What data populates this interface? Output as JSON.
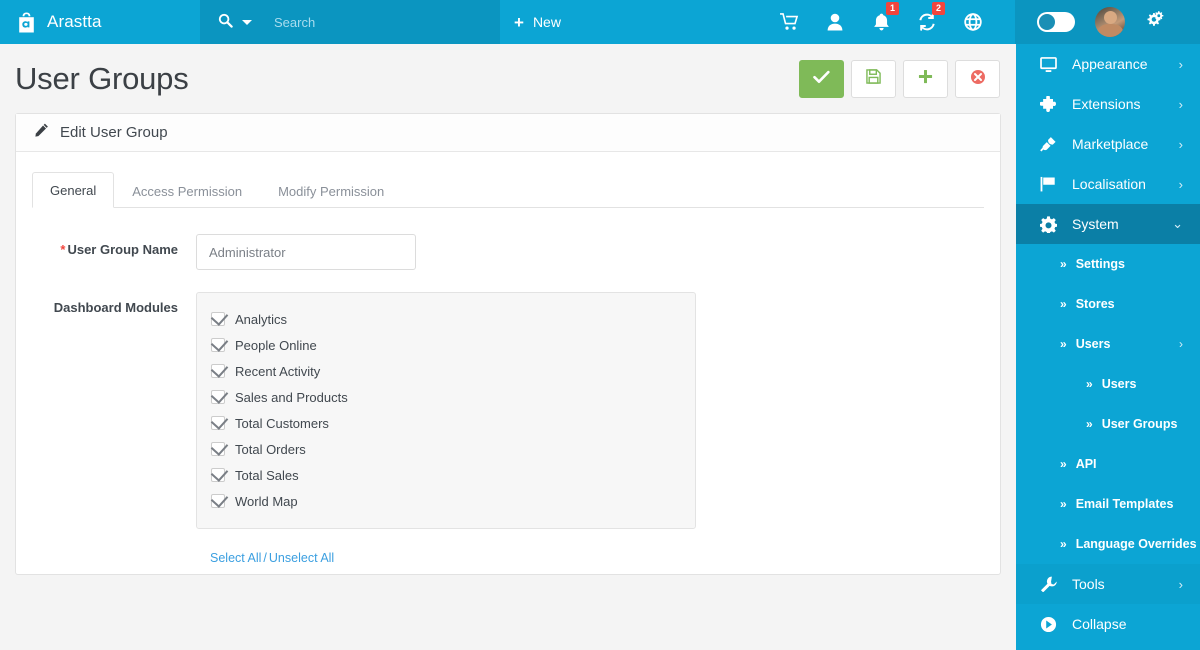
{
  "topbar": {
    "brand": "Arastta",
    "brand_icon": "arastta-logo-icon",
    "search_placeholder": "Search",
    "search_value": "",
    "search_icon": "search-icon",
    "search_caret_icon": "caret-down-icon",
    "new_label": "New",
    "new_icon": "plus-icon",
    "icons": [
      {
        "name": "cart-icon",
        "badge": ""
      },
      {
        "name": "user-icon",
        "badge": ""
      },
      {
        "name": "bell-icon",
        "badge": "1"
      },
      {
        "name": "sync-icon",
        "badge": "2"
      },
      {
        "name": "help-globe-icon",
        "badge": ""
      }
    ],
    "toggle_name": "dark-mode-toggle",
    "avatar_name": "user-avatar",
    "settings_icon": "gears-icon"
  },
  "page": {
    "title": "User Groups",
    "actions": [
      {
        "name": "save-button",
        "icon": "check-icon",
        "style": "primary"
      },
      {
        "name": "save-and-stay-button",
        "icon": "floppy-disk-icon",
        "style": "outline-green"
      },
      {
        "name": "add-new-button",
        "icon": "plus-icon",
        "style": "outline-green"
      },
      {
        "name": "cancel-button",
        "icon": "cancel-circle-icon",
        "style": "outline-red"
      }
    ]
  },
  "panel": {
    "header_icon": "pencil-icon",
    "header_title": "Edit User Group",
    "tabs": [
      {
        "label": "General",
        "active": true
      },
      {
        "label": "Access Permission",
        "active": false
      },
      {
        "label": "Modify Permission",
        "active": false
      }
    ],
    "form": {
      "group_name_label": "User Group Name",
      "group_name_required": "*",
      "group_name_value": "Administrator",
      "group_name_placeholder": "",
      "dashboard_modules_label": "Dashboard Modules",
      "modules": [
        {
          "label": "Analytics",
          "checked": true
        },
        {
          "label": "People Online",
          "checked": true
        },
        {
          "label": "Recent Activity",
          "checked": true
        },
        {
          "label": "Sales and Products",
          "checked": true
        },
        {
          "label": "Total Customers",
          "checked": true
        },
        {
          "label": "Total Orders",
          "checked": true
        },
        {
          "label": "Total Sales",
          "checked": true
        },
        {
          "label": "World Map",
          "checked": true
        }
      ],
      "select_all_label": "Select All",
      "separator": "/",
      "unselect_all_label": "Unselect All"
    }
  },
  "sidebar": {
    "items": [
      {
        "label": "Appearance",
        "icon": "monitor-icon",
        "chevron": "›"
      },
      {
        "label": "Extensions",
        "icon": "puzzle-icon",
        "chevron": "›"
      },
      {
        "label": "Marketplace",
        "icon": "plug-icon",
        "chevron": "›"
      },
      {
        "label": "Localisation",
        "icon": "flag-icon",
        "chevron": "›"
      },
      {
        "label": "System",
        "icon": "gear-icon",
        "chevron": "⌄",
        "active": true
      }
    ],
    "system_children": [
      {
        "label": "Settings",
        "arrows": "»"
      },
      {
        "label": "Stores",
        "arrows": "»"
      },
      {
        "label": "Users",
        "arrows": "»",
        "chevron": "›"
      },
      {
        "label": "Users",
        "arrows": "»",
        "nested": true
      },
      {
        "label": "User Groups",
        "arrows": "»",
        "nested": true
      },
      {
        "label": "API",
        "arrows": "»"
      },
      {
        "label": "Email Templates",
        "arrows": "»"
      },
      {
        "label": "Language Overrides",
        "arrows": "»"
      }
    ],
    "footer_items": [
      {
        "label": "Tools",
        "icon": "wrench-icon",
        "chevron": "›"
      },
      {
        "label": "Collapse",
        "icon": "collapse-icon",
        "chevron": ""
      }
    ]
  },
  "colors": {
    "brand_blue": "#0ca5d4",
    "brand_blue_dark": "#0b95c0",
    "sidebar_active": "#0b7fa6",
    "accent_green": "#7fba58",
    "danger_red": "#f1453d",
    "link_blue": "#3b9fe0",
    "page_bg": "#f4f4f4"
  }
}
